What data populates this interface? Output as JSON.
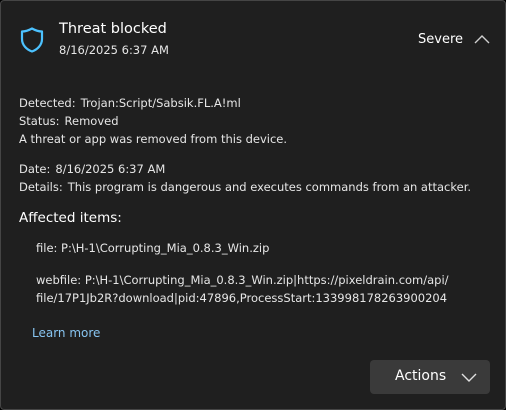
{
  "header": {
    "title": "Threat blocked",
    "timestamp": "8/16/2025 6:37 AM",
    "severity": "Severe",
    "icon": "shield-icon",
    "accent_color": "#4cc2ff"
  },
  "details": {
    "detected_label": "Detected:",
    "detected_value": "Trojan:Script/Sabsik.FL.A!ml",
    "status_label": "Status:",
    "status_value": "Removed",
    "status_description": "A threat or app was removed from this device.",
    "date_label": "Date:",
    "date_value": "8/16/2025 6:37 AM",
    "details_label": "Details:",
    "details_value": "This program is dangerous and executes commands from an attacker."
  },
  "affected": {
    "heading": "Affected items:",
    "items": [
      "file: P:\\H-1\\Corrupting_Mia_0.8.3_Win.zip",
      "webfile: P:\\H-1\\Corrupting_Mia_0.8.3_Win.zip|https://pixeldrain.com/api/",
      "file/17P1Jb2R?download|pid:47896,ProcessStart:133998178263900204"
    ]
  },
  "links": {
    "learn_more": "Learn more"
  },
  "buttons": {
    "actions": "Actions"
  }
}
